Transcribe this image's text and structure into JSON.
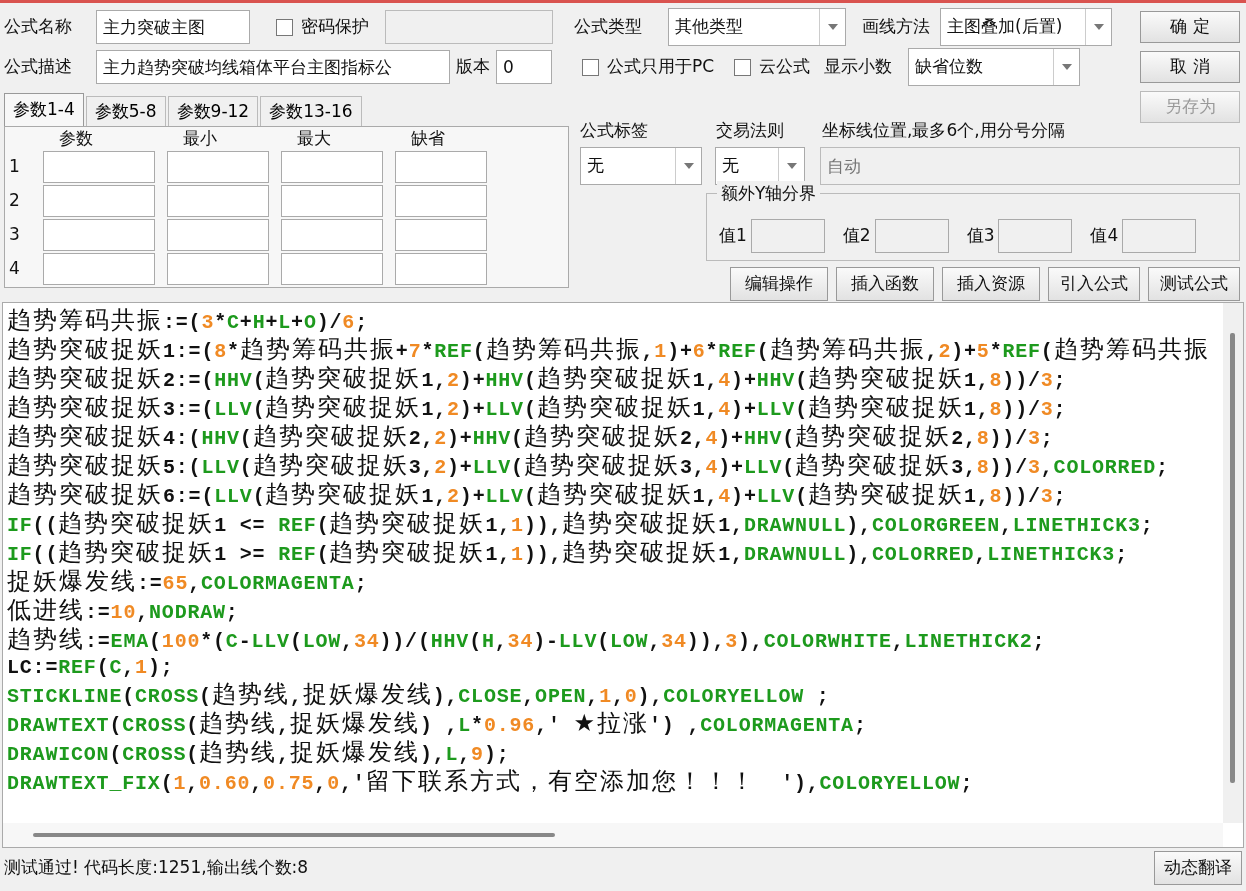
{
  "formula_name": {
    "label": "公式名称",
    "value": "主力突破主图"
  },
  "password": {
    "label": "密码保护",
    "checked": false
  },
  "description": {
    "label": "公式描述",
    "value": "主力趋势突破均线箱体平台主图指标公"
  },
  "version": {
    "label": "版本",
    "value": "0"
  },
  "tabs": [
    {
      "label": "参数1-4",
      "selected": true
    },
    {
      "label": "参数5-8",
      "selected": false
    },
    {
      "label": "参数9-12",
      "selected": false
    },
    {
      "label": "参数13-16",
      "selected": false
    }
  ],
  "param_columns": [
    "参数",
    "最小",
    "最大",
    "缺省"
  ],
  "param_rows": [
    "1",
    "2",
    "3",
    "4"
  ],
  "formula_type": {
    "label": "公式类型",
    "value": "其他类型"
  },
  "draw_method": {
    "label": "画线方法",
    "value": "主图叠加(后置)"
  },
  "pc_only": {
    "label": "公式只用于PC",
    "checked": false
  },
  "cloud": {
    "label": "云公式",
    "checked": false
  },
  "decimals": {
    "label": "显示小数",
    "value": "缺省位数"
  },
  "side_buttons": [
    {
      "label": "确 定",
      "disabled": false
    },
    {
      "label": "取 消",
      "disabled": false
    },
    {
      "label": "另存为",
      "disabled": true
    }
  ],
  "tag": {
    "label": "公式标签",
    "value": "无"
  },
  "trade_rule": {
    "label": "交易法则",
    "value": "无"
  },
  "axis_lines": {
    "label": "坐标线位置,最多6个,用分号分隔",
    "placeholder": "自动"
  },
  "extra_y": {
    "title": "额外Y轴分界",
    "fields": [
      "值1",
      "值2",
      "值3",
      "值4"
    ]
  },
  "action_buttons": [
    "编辑操作",
    "插入函数",
    "插入资源",
    "引入公式",
    "测试公式"
  ],
  "code_lines": [
    [
      {
        "kind": "plain",
        "text": "趋势筹码共振:=("
      },
      {
        "kind": "num",
        "text": "3"
      },
      {
        "kind": "plain",
        "text": "*"
      },
      {
        "kind": "func",
        "text": "C"
      },
      {
        "kind": "plain",
        "text": "+"
      },
      {
        "kind": "func",
        "text": "H"
      },
      {
        "kind": "plain",
        "text": "+"
      },
      {
        "kind": "func",
        "text": "L"
      },
      {
        "kind": "plain",
        "text": "+"
      },
      {
        "kind": "func",
        "text": "O"
      },
      {
        "kind": "plain",
        "text": ")/"
      },
      {
        "kind": "num",
        "text": "6"
      },
      {
        "kind": "plain",
        "text": ";"
      }
    ],
    [
      {
        "kind": "plain",
        "text": "趋势突破捉妖1:=("
      },
      {
        "kind": "num",
        "text": "8"
      },
      {
        "kind": "plain",
        "text": "*趋势筹码共振+"
      },
      {
        "kind": "num",
        "text": "7"
      },
      {
        "kind": "plain",
        "text": "*"
      },
      {
        "kind": "func",
        "text": "REF"
      },
      {
        "kind": "plain",
        "text": "(趋势筹码共振,"
      },
      {
        "kind": "num",
        "text": "1"
      },
      {
        "kind": "plain",
        "text": ")+"
      },
      {
        "kind": "num",
        "text": "6"
      },
      {
        "kind": "plain",
        "text": "*"
      },
      {
        "kind": "func",
        "text": "REF"
      },
      {
        "kind": "plain",
        "text": "(趋势筹码共振,"
      },
      {
        "kind": "num",
        "text": "2"
      },
      {
        "kind": "plain",
        "text": ")+"
      },
      {
        "kind": "num",
        "text": "5"
      },
      {
        "kind": "plain",
        "text": "*"
      },
      {
        "kind": "func",
        "text": "REF"
      },
      {
        "kind": "plain",
        "text": "(趋势筹码共振"
      }
    ],
    [
      {
        "kind": "plain",
        "text": "趋势突破捉妖2:=("
      },
      {
        "kind": "func",
        "text": "HHV"
      },
      {
        "kind": "plain",
        "text": "(趋势突破捉妖1,"
      },
      {
        "kind": "num",
        "text": "2"
      },
      {
        "kind": "plain",
        "text": ")+"
      },
      {
        "kind": "func",
        "text": "HHV"
      },
      {
        "kind": "plain",
        "text": "(趋势突破捉妖1,"
      },
      {
        "kind": "num",
        "text": "4"
      },
      {
        "kind": "plain",
        "text": ")+"
      },
      {
        "kind": "func",
        "text": "HHV"
      },
      {
        "kind": "plain",
        "text": "(趋势突破捉妖1,"
      },
      {
        "kind": "num",
        "text": "8"
      },
      {
        "kind": "plain",
        "text": "))/"
      },
      {
        "kind": "num",
        "text": "3"
      },
      {
        "kind": "plain",
        "text": ";"
      }
    ],
    [
      {
        "kind": "plain",
        "text": "趋势突破捉妖3:=("
      },
      {
        "kind": "func",
        "text": "LLV"
      },
      {
        "kind": "plain",
        "text": "(趋势突破捉妖1,"
      },
      {
        "kind": "num",
        "text": "2"
      },
      {
        "kind": "plain",
        "text": ")+"
      },
      {
        "kind": "func",
        "text": "LLV"
      },
      {
        "kind": "plain",
        "text": "(趋势突破捉妖1,"
      },
      {
        "kind": "num",
        "text": "4"
      },
      {
        "kind": "plain",
        "text": ")+"
      },
      {
        "kind": "func",
        "text": "LLV"
      },
      {
        "kind": "plain",
        "text": "(趋势突破捉妖1,"
      },
      {
        "kind": "num",
        "text": "8"
      },
      {
        "kind": "plain",
        "text": "))/"
      },
      {
        "kind": "num",
        "text": "3"
      },
      {
        "kind": "plain",
        "text": ";"
      }
    ],
    [
      {
        "kind": "plain",
        "text": "趋势突破捉妖4:("
      },
      {
        "kind": "func",
        "text": "HHV"
      },
      {
        "kind": "plain",
        "text": "(趋势突破捉妖2,"
      },
      {
        "kind": "num",
        "text": "2"
      },
      {
        "kind": "plain",
        "text": ")+"
      },
      {
        "kind": "func",
        "text": "HHV"
      },
      {
        "kind": "plain",
        "text": "(趋势突破捉妖2,"
      },
      {
        "kind": "num",
        "text": "4"
      },
      {
        "kind": "plain",
        "text": ")+"
      },
      {
        "kind": "func",
        "text": "HHV"
      },
      {
        "kind": "plain",
        "text": "(趋势突破捉妖2,"
      },
      {
        "kind": "num",
        "text": "8"
      },
      {
        "kind": "plain",
        "text": "))/"
      },
      {
        "kind": "num",
        "text": "3"
      },
      {
        "kind": "plain",
        "text": ";"
      }
    ],
    [
      {
        "kind": "plain",
        "text": "趋势突破捉妖5:("
      },
      {
        "kind": "func",
        "text": "LLV"
      },
      {
        "kind": "plain",
        "text": "(趋势突破捉妖3,"
      },
      {
        "kind": "num",
        "text": "2"
      },
      {
        "kind": "plain",
        "text": ")+"
      },
      {
        "kind": "func",
        "text": "LLV"
      },
      {
        "kind": "plain",
        "text": "(趋势突破捉妖3,"
      },
      {
        "kind": "num",
        "text": "4"
      },
      {
        "kind": "plain",
        "text": ")+"
      },
      {
        "kind": "func",
        "text": "LLV"
      },
      {
        "kind": "plain",
        "text": "(趋势突破捉妖3,"
      },
      {
        "kind": "num",
        "text": "8"
      },
      {
        "kind": "plain",
        "text": "))/"
      },
      {
        "kind": "num",
        "text": "3"
      },
      {
        "kind": "plain",
        "text": ","
      },
      {
        "kind": "func",
        "text": "COLORRED"
      },
      {
        "kind": "plain",
        "text": ";"
      }
    ],
    [
      {
        "kind": "plain",
        "text": "趋势突破捉妖6:=("
      },
      {
        "kind": "func",
        "text": "LLV"
      },
      {
        "kind": "plain",
        "text": "(趋势突破捉妖1,"
      },
      {
        "kind": "num",
        "text": "2"
      },
      {
        "kind": "plain",
        "text": ")+"
      },
      {
        "kind": "func",
        "text": "LLV"
      },
      {
        "kind": "plain",
        "text": "(趋势突破捉妖1,"
      },
      {
        "kind": "num",
        "text": "4"
      },
      {
        "kind": "plain",
        "text": ")+"
      },
      {
        "kind": "func",
        "text": "LLV"
      },
      {
        "kind": "plain",
        "text": "(趋势突破捉妖1,"
      },
      {
        "kind": "num",
        "text": "8"
      },
      {
        "kind": "plain",
        "text": "))/"
      },
      {
        "kind": "num",
        "text": "3"
      },
      {
        "kind": "plain",
        "text": ";"
      }
    ],
    [
      {
        "kind": "func",
        "text": "IF"
      },
      {
        "kind": "plain",
        "text": "((趋势突破捉妖1 <= "
      },
      {
        "kind": "func",
        "text": "REF"
      },
      {
        "kind": "plain",
        "text": "(趋势突破捉妖1,"
      },
      {
        "kind": "num",
        "text": "1"
      },
      {
        "kind": "plain",
        "text": ")),趋势突破捉妖1,"
      },
      {
        "kind": "func",
        "text": "DRAWNULL"
      },
      {
        "kind": "plain",
        "text": "),"
      },
      {
        "kind": "func",
        "text": "COLORGREEN"
      },
      {
        "kind": "plain",
        "text": ","
      },
      {
        "kind": "func",
        "text": "LINETHICK3"
      },
      {
        "kind": "plain",
        "text": ";"
      }
    ],
    [
      {
        "kind": "func",
        "text": "IF"
      },
      {
        "kind": "plain",
        "text": "((趋势突破捉妖1 >= "
      },
      {
        "kind": "func",
        "text": "REF"
      },
      {
        "kind": "plain",
        "text": "(趋势突破捉妖1,"
      },
      {
        "kind": "num",
        "text": "1"
      },
      {
        "kind": "plain",
        "text": ")),趋势突破捉妖1,"
      },
      {
        "kind": "func",
        "text": "DRAWNULL"
      },
      {
        "kind": "plain",
        "text": "),"
      },
      {
        "kind": "func",
        "text": "COLORRED"
      },
      {
        "kind": "plain",
        "text": ","
      },
      {
        "kind": "func",
        "text": "LINETHICK3"
      },
      {
        "kind": "plain",
        "text": ";"
      }
    ],
    [
      {
        "kind": "plain",
        "text": "捉妖爆发线:="
      },
      {
        "kind": "num",
        "text": "65"
      },
      {
        "kind": "plain",
        "text": ","
      },
      {
        "kind": "func",
        "text": "COLORMAGENTA"
      },
      {
        "kind": "plain",
        "text": ";"
      }
    ],
    [
      {
        "kind": "plain",
        "text": "低进线:="
      },
      {
        "kind": "num",
        "text": "10"
      },
      {
        "kind": "plain",
        "text": ","
      },
      {
        "kind": "func",
        "text": "NODRAW"
      },
      {
        "kind": "plain",
        "text": ";"
      }
    ],
    [
      {
        "kind": "plain",
        "text": "趋势线:="
      },
      {
        "kind": "func",
        "text": "EMA"
      },
      {
        "kind": "plain",
        "text": "("
      },
      {
        "kind": "num",
        "text": "100"
      },
      {
        "kind": "plain",
        "text": "*("
      },
      {
        "kind": "func",
        "text": "C"
      },
      {
        "kind": "plain",
        "text": "-"
      },
      {
        "kind": "func",
        "text": "LLV"
      },
      {
        "kind": "plain",
        "text": "("
      },
      {
        "kind": "func",
        "text": "LOW"
      },
      {
        "kind": "plain",
        "text": ","
      },
      {
        "kind": "num",
        "text": "34"
      },
      {
        "kind": "plain",
        "text": "))/("
      },
      {
        "kind": "func",
        "text": "HHV"
      },
      {
        "kind": "plain",
        "text": "("
      },
      {
        "kind": "func",
        "text": "H"
      },
      {
        "kind": "plain",
        "text": ","
      },
      {
        "kind": "num",
        "text": "34"
      },
      {
        "kind": "plain",
        "text": ")-"
      },
      {
        "kind": "func",
        "text": "LLV"
      },
      {
        "kind": "plain",
        "text": "("
      },
      {
        "kind": "func",
        "text": "LOW"
      },
      {
        "kind": "plain",
        "text": ","
      },
      {
        "kind": "num",
        "text": "34"
      },
      {
        "kind": "plain",
        "text": ")),"
      },
      {
        "kind": "num",
        "text": "3"
      },
      {
        "kind": "plain",
        "text": "),"
      },
      {
        "kind": "func",
        "text": "COLORWHITE"
      },
      {
        "kind": "plain",
        "text": ","
      },
      {
        "kind": "func",
        "text": "LINETHICK2"
      },
      {
        "kind": "plain",
        "text": ";"
      }
    ],
    [
      {
        "kind": "plain",
        "text": "LC:="
      },
      {
        "kind": "func",
        "text": "REF"
      },
      {
        "kind": "plain",
        "text": "("
      },
      {
        "kind": "func",
        "text": "C"
      },
      {
        "kind": "plain",
        "text": ","
      },
      {
        "kind": "num",
        "text": "1"
      },
      {
        "kind": "plain",
        "text": ");"
      }
    ],
    [
      {
        "kind": "func",
        "text": "STICKLINE"
      },
      {
        "kind": "plain",
        "text": "("
      },
      {
        "kind": "func",
        "text": "CROSS"
      },
      {
        "kind": "plain",
        "text": "(趋势线,捉妖爆发线),"
      },
      {
        "kind": "func",
        "text": "CLOSE"
      },
      {
        "kind": "plain",
        "text": ","
      },
      {
        "kind": "func",
        "text": "OPEN"
      },
      {
        "kind": "plain",
        "text": ","
      },
      {
        "kind": "num",
        "text": "1"
      },
      {
        "kind": "plain",
        "text": ","
      },
      {
        "kind": "num",
        "text": "0"
      },
      {
        "kind": "plain",
        "text": "),"
      },
      {
        "kind": "func",
        "text": "COLORYELLOW"
      },
      {
        "kind": "plain",
        "text": " ;"
      }
    ],
    [
      {
        "kind": "func",
        "text": "DRAWTEXT"
      },
      {
        "kind": "plain",
        "text": "("
      },
      {
        "kind": "func",
        "text": "CROSS"
      },
      {
        "kind": "plain",
        "text": "(趋势线,捉妖爆发线) ,"
      },
      {
        "kind": "func",
        "text": "L"
      },
      {
        "kind": "plain",
        "text": "*"
      },
      {
        "kind": "num",
        "text": "0.96"
      },
      {
        "kind": "plain",
        "text": ",' ★拉涨') ,"
      },
      {
        "kind": "func",
        "text": "COLORMAGENTA"
      },
      {
        "kind": "plain",
        "text": ";"
      }
    ],
    [
      {
        "kind": "func",
        "text": "DRAWICON"
      },
      {
        "kind": "plain",
        "text": "("
      },
      {
        "kind": "func",
        "text": "CROSS"
      },
      {
        "kind": "plain",
        "text": "(趋势线,捉妖爆发线),"
      },
      {
        "kind": "func",
        "text": "L"
      },
      {
        "kind": "plain",
        "text": ","
      },
      {
        "kind": "num",
        "text": "9"
      },
      {
        "kind": "plain",
        "text": ");"
      }
    ],
    [
      {
        "kind": "func",
        "text": "DRAWTEXT_FIX"
      },
      {
        "kind": "plain",
        "text": "("
      },
      {
        "kind": "num",
        "text": "1"
      },
      {
        "kind": "plain",
        "text": ","
      },
      {
        "kind": "num",
        "text": "0.60"
      },
      {
        "kind": "plain",
        "text": ","
      },
      {
        "kind": "num",
        "text": "0.75"
      },
      {
        "kind": "plain",
        "text": ","
      },
      {
        "kind": "num",
        "text": "0"
      },
      {
        "kind": "plain",
        "text": ",'留下联系方式，有空添加您！！！  '),"
      },
      {
        "kind": "func",
        "text": "COLORYELLOW"
      },
      {
        "kind": "plain",
        "text": ";"
      }
    ]
  ],
  "status": "测试通过! 代码长度:1251,输出线个数:8",
  "translate_button": "动态翻译"
}
